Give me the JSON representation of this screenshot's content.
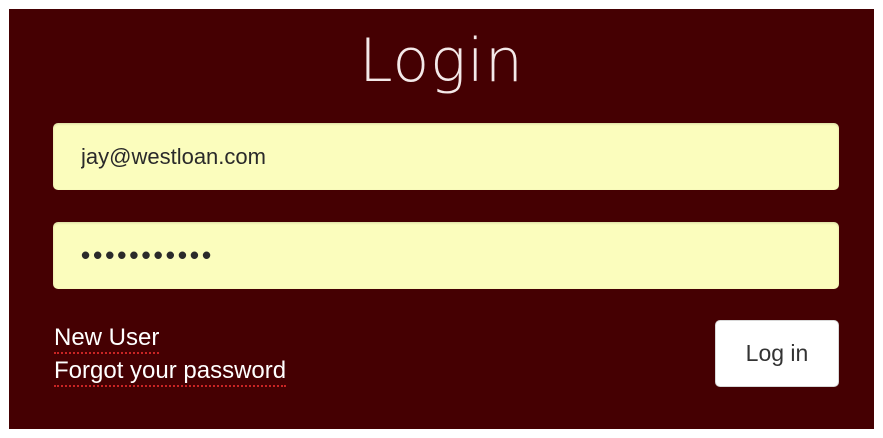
{
  "login": {
    "title": "Login",
    "email_value": "jay@westloan.com",
    "password_value": "•••••••••••",
    "new_user_label": "New User",
    "forgot_password_label": "Forgot your password",
    "submit_label": "Log in"
  },
  "colors": {
    "panel_background": "#450002",
    "input_background": "#fbfdbd",
    "link_underline": "#c92424",
    "button_background": "#ffffff"
  }
}
